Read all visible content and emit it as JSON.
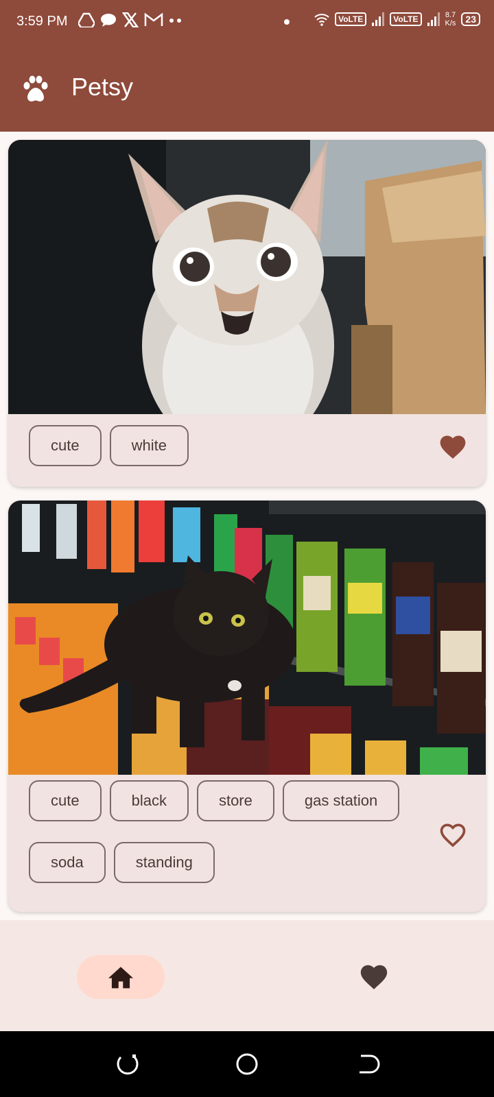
{
  "status_bar": {
    "time": "3:59 PM",
    "sim1": "VoLTE",
    "sim2": "VoLTE",
    "speed_value": "8.7",
    "speed_unit": "K/s",
    "battery": "23"
  },
  "app_bar": {
    "title": "Petsy",
    "logo_icon": "paw-icon"
  },
  "posts": [
    {
      "photo": "white-cat-photo",
      "tags": [
        "cute",
        "white"
      ],
      "favorited": true
    },
    {
      "photo": "black-cat-photo",
      "tags": [
        "cute",
        "black",
        "store",
        "gas station",
        "soda",
        "standing"
      ],
      "favorited": false
    }
  ],
  "bottom_nav": {
    "items": [
      {
        "icon": "home-icon",
        "selected": true
      },
      {
        "icon": "heart-icon",
        "selected": false
      }
    ]
  },
  "colors": {
    "primary": "#8e4a3b",
    "card_bg": "#f1e3e1",
    "nav_indicator": "#ffd9cd",
    "heart": "#8e4a3b"
  }
}
